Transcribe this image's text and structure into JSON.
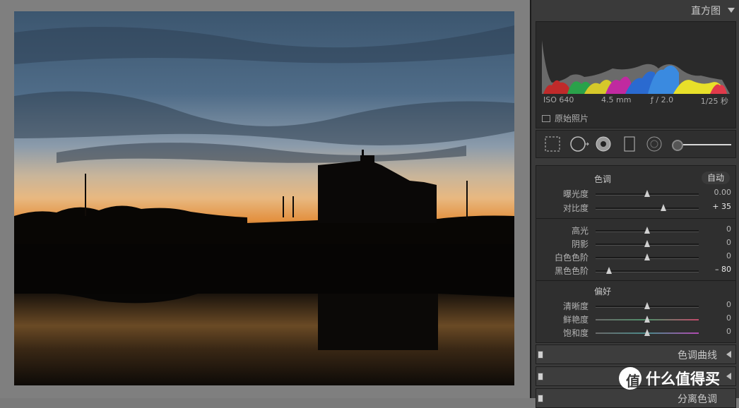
{
  "histogram": {
    "title": "直方图",
    "iso": "ISO 640",
    "focal": "4.5 mm",
    "aperture": "ƒ / 2.0",
    "shutter": "1/25 秒",
    "original_photo": "原始照片"
  },
  "basic": {
    "tone_label": "色调",
    "auto_label": "自动",
    "presence_label": "偏好",
    "sliders": [
      {
        "label": "曝光度",
        "value": "0.00",
        "position": 0.5
      },
      {
        "label": "对比度",
        "value": "+ 35",
        "position": 0.66
      },
      {
        "label": "高光",
        "value": "0",
        "position": 0.5
      },
      {
        "label": "阴影",
        "value": "0",
        "position": 0.5
      },
      {
        "label": "白色色阶",
        "value": "0",
        "position": 0.5
      },
      {
        "label": "黑色色阶",
        "value": "– 80",
        "position": 0.13
      },
      {
        "label": "清晰度",
        "value": "0",
        "position": 0.5
      },
      {
        "label": "鲜艳度",
        "value": "0",
        "position": 0.5
      },
      {
        "label": "饱和度",
        "value": "0",
        "position": 0.5
      }
    ]
  },
  "panels": {
    "tone_curve": "色调曲线",
    "hsl": "",
    "split_toning": "分离色调"
  },
  "watermark": {
    "badge": "值",
    "text": "什么值得买"
  },
  "icons": [
    "crop-icon",
    "spot-removal-icon",
    "red-eye-icon",
    "graduated-filter-icon",
    "radial-filter-icon",
    "adjustment-brush-icon"
  ],
  "colors": {
    "panel_bg": "#3a3a3a",
    "photo_bg": "#7f7f7f"
  }
}
